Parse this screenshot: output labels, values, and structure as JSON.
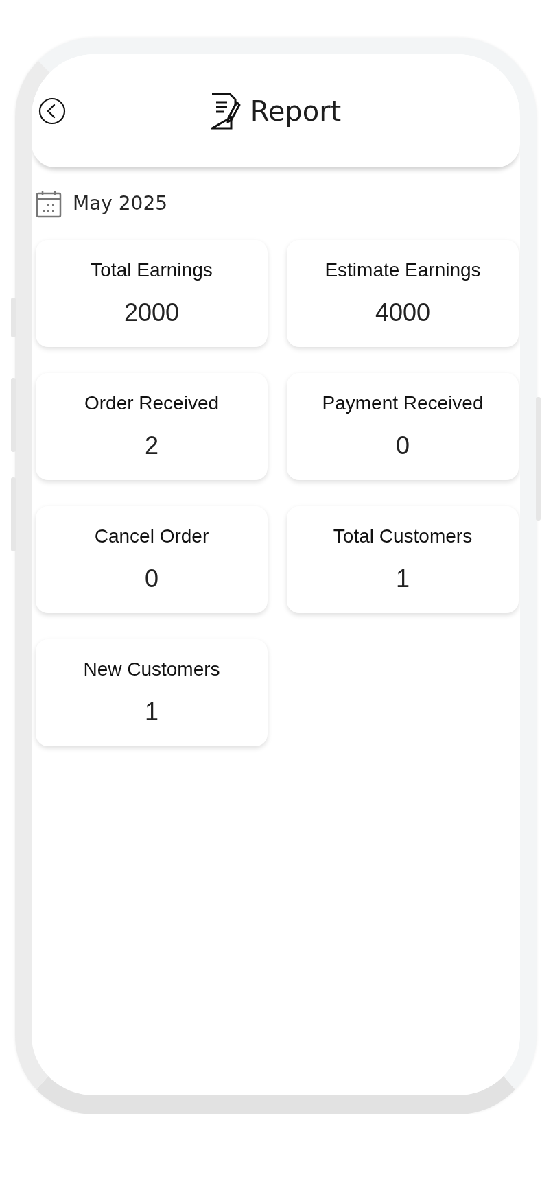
{
  "header": {
    "title": "Report"
  },
  "period": {
    "label": "May 2025"
  },
  "stats": [
    {
      "label": "Total Earnings",
      "value": "2000"
    },
    {
      "label": "Estimate Earnings",
      "value": "4000"
    },
    {
      "label": "Order Received",
      "value": "2"
    },
    {
      "label": "Payment Received",
      "value": "0"
    },
    {
      "label": "Cancel Order",
      "value": "0"
    },
    {
      "label": "Total Customers",
      "value": "1"
    },
    {
      "label": "New Customers",
      "value": "1"
    }
  ]
}
